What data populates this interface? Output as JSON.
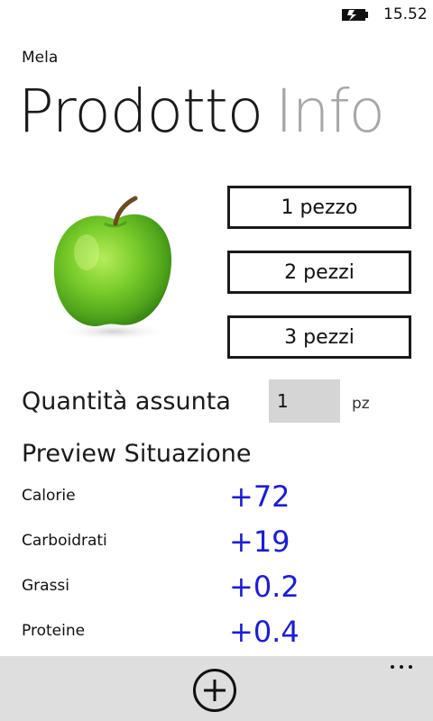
{
  "status_bar": {
    "time": "15.52",
    "battery_icon": "battery-charging-icon"
  },
  "app": {
    "name": "Mela"
  },
  "pivot": {
    "active": "Prodotto",
    "inactive": "Info"
  },
  "product_image": {
    "icon": "green-apple-image"
  },
  "quantity_buttons": [
    "1 pezzo",
    "2 pezzi",
    "3 pezzi"
  ],
  "quantity": {
    "label": "Quantità assunta",
    "value": "1",
    "unit": "pz"
  },
  "preview": {
    "title": "Preview Situazione",
    "rows": [
      {
        "label": "Calorie",
        "value": "+72"
      },
      {
        "label": "Carboidrati",
        "value": "+19"
      },
      {
        "label": "Grassi",
        "value": "+0.2"
      },
      {
        "label": "Proteine",
        "value": "+0.4"
      }
    ]
  },
  "app_bar": {
    "add_icon": "add-circle-icon",
    "more_icon": "more-ellipsis-icon"
  },
  "colors": {
    "accent_value": "#1c1cd6",
    "app_bar_bg": "#dedede",
    "input_bg": "#d5d5d5"
  }
}
